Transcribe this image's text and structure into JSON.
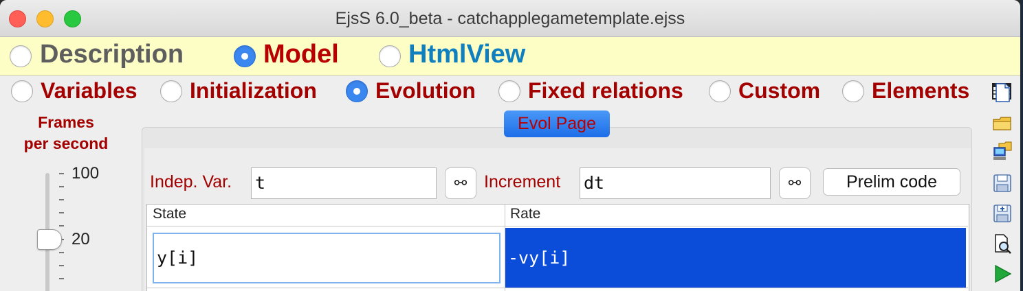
{
  "window": {
    "title": "EjsS 6.0_beta - catchapplegametemplate.ejss"
  },
  "main_tabs": [
    {
      "label": "Description",
      "selected": false,
      "color": "#5e5e5e"
    },
    {
      "label": "Model",
      "selected": true,
      "color": "#b80000"
    },
    {
      "label": "HtmlView",
      "selected": false,
      "color": "#0f7fc0"
    }
  ],
  "sub_tabs": [
    {
      "label": "Variables",
      "selected": false
    },
    {
      "label": "Initialization",
      "selected": false
    },
    {
      "label": "Evolution",
      "selected": true
    },
    {
      "label": "Fixed relations",
      "selected": false
    },
    {
      "label": "Custom",
      "selected": false
    },
    {
      "label": "Elements",
      "selected": false
    }
  ],
  "fps": {
    "label_line1": "Frames",
    "label_line2": "per second",
    "max_label": "100",
    "current_label": "20",
    "value": 20
  },
  "page": {
    "button_label": "Evol Page"
  },
  "fields": {
    "indep_label": "Indep. Var.",
    "indep_value": "t",
    "increment_label": "Increment",
    "increment_value": "dt",
    "prelim_label": "Prelim code"
  },
  "table": {
    "headers": [
      "State",
      "Rate"
    ],
    "rows": [
      {
        "state": "y[i]",
        "rate": "-vy[i]"
      }
    ]
  },
  "toolbar": [
    "new-file-icon",
    "open-folder-icon",
    "open-remote-icon",
    "save-icon",
    "save-as-icon",
    "inspect-icon",
    "run-icon"
  ],
  "colors": {
    "selected_radio": "#3b87f0",
    "label_red": "#a30000",
    "selection_blue": "#0b4dd8",
    "header_yellow": "#fdfdc6"
  }
}
